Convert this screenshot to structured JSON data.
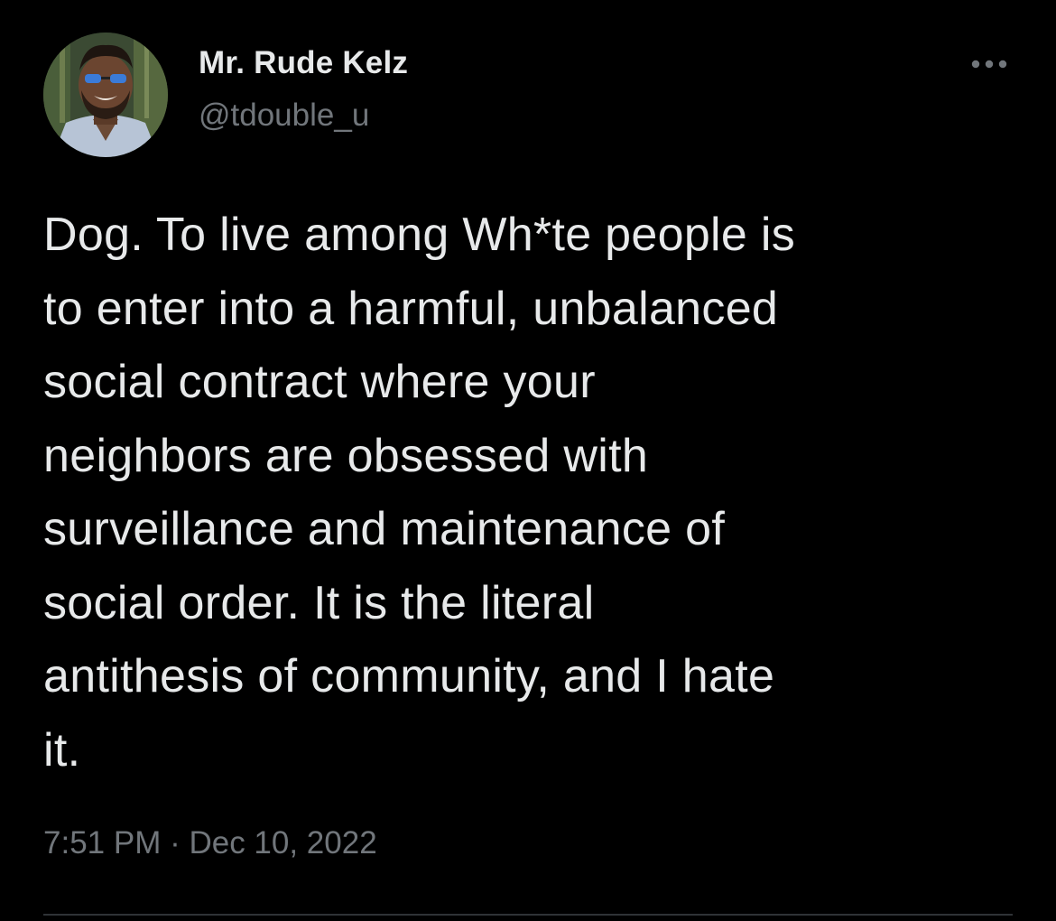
{
  "tweet": {
    "author": {
      "display_name": "Mr. Rude Kelz",
      "handle": "@tdouble_u"
    },
    "text": "Dog. To live among Wh*te people is\nto enter into a harmful, unbalanced\nsocial contract where your\nneighbors are obsessed with\nsurveillance and maintenance of\nsocial order. It is the literal\nantithesis of community, and I hate\nit.",
    "timestamp": "7:51 PM · Dec 10, 2022"
  },
  "icons": {
    "more": "more-horizontal-icon"
  },
  "colors": {
    "background": "#000000",
    "primary_text": "#e7e9ea",
    "secondary_text": "#71767b",
    "divider": "#2f3336"
  }
}
